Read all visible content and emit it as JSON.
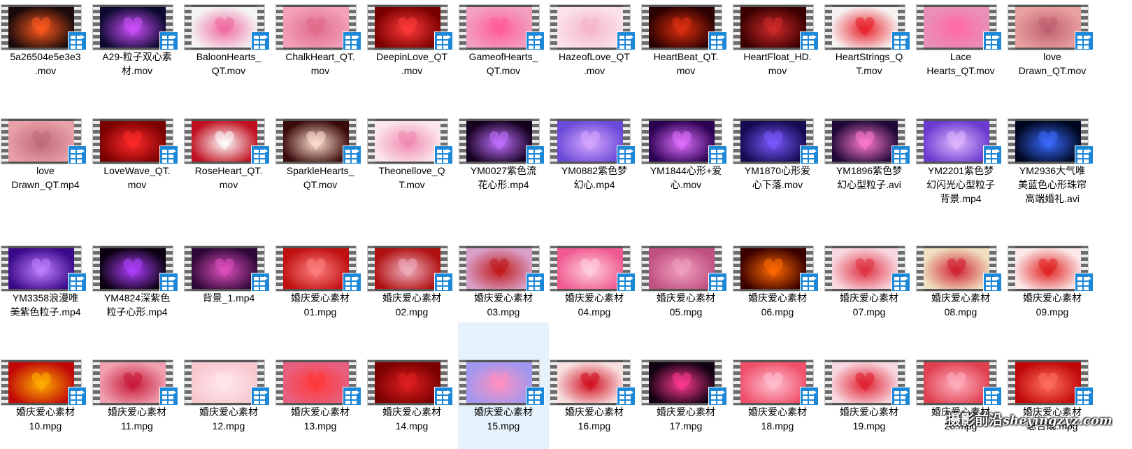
{
  "files": [
    {
      "name": "5a26504e5e3e3\n.mov",
      "colors": [
        "#1a0a0a",
        "#ff5a1e"
      ]
    },
    {
      "name": "A29-粒子双心素\n材.mov",
      "colors": [
        "#0c0a30",
        "#d050ff"
      ]
    },
    {
      "name": "BaloonHearts_\nQT.mov",
      "colors": [
        "#f4f4f4",
        "#f06aa0"
      ]
    },
    {
      "name": "ChalkHeart_QT.\nmov",
      "colors": [
        "#f3a0b8",
        "#e06a8a"
      ]
    },
    {
      "name": "DeepinLove_QT\n.mov",
      "colors": [
        "#7a0000",
        "#ff3a3a"
      ]
    },
    {
      "name": "GameofHearts_\nQT.mov",
      "colors": [
        "#f2a0c0",
        "#ff5c98"
      ]
    },
    {
      "name": "HazeofLove_QT\n.mov",
      "colors": [
        "#fbe2ea",
        "#f5b5c8"
      ]
    },
    {
      "name": "HeartBeat_QT.\nmov",
      "colors": [
        "#2a0000",
        "#e03010"
      ]
    },
    {
      "name": "HeartFloat_HD.\nmov",
      "colors": [
        "#3a0000",
        "#d02a2a"
      ]
    },
    {
      "name": "HeartStrings_Q\nT.mov",
      "colors": [
        "#f7f2f2",
        "#e8202a"
      ]
    },
    {
      "name": "Lace\nHearts_QT.mov",
      "colors": [
        "#e890b8",
        "#ff6aa8"
      ]
    },
    {
      "name": "love\nDrawn_QT.mov",
      "colors": [
        "#e8a0a0",
        "#c06070"
      ]
    },
    {
      "name": "love\nDrawn_QT.mp4",
      "colors": [
        "#e8a0a8",
        "#c06a78"
      ]
    },
    {
      "name": "LoveWave_QT.\nmov",
      "colors": [
        "#7a0000",
        "#ff2a2a"
      ]
    },
    {
      "name": "RoseHeart_QT.\nmov",
      "colors": [
        "#c01020",
        "#ffffff"
      ]
    },
    {
      "name": "SparkleHearts_\nQT.mov",
      "colors": [
        "#3a0a0a",
        "#ffe0d0"
      ]
    },
    {
      "name": "Theonellove_Q\nT.mov",
      "colors": [
        "#fbe6ee",
        "#f08ab0"
      ]
    },
    {
      "name": "YM0027紫色流\n花心形.mp4",
      "colors": [
        "#14001e",
        "#c070ff"
      ]
    },
    {
      "name": "YM0882紫色梦\n幻心.mp4",
      "colors": [
        "#6a4ad8",
        "#d8a8ff"
      ]
    },
    {
      "name": "YM1844心形+爱\n心.mov",
      "colors": [
        "#2a0050",
        "#e070ff"
      ]
    },
    {
      "name": "YM1870心形爱\n心下落.mov",
      "colors": [
        "#140a50",
        "#7a5aff"
      ]
    },
    {
      "name": "YM1896紫色梦\n幻心型粒子.avi",
      "colors": [
        "#20083a",
        "#ff7ad0"
      ]
    },
    {
      "name": "YM2201紫色梦\n幻闪光心型粒子\n背景.mp4",
      "colors": [
        "#6a3ad0",
        "#e0b8ff"
      ]
    },
    {
      "name": "YM2936大气唯\n美蓝色心形珠帘\n高端婚礼.avi",
      "colors": [
        "#000820",
        "#3a6aff"
      ]
    },
    {
      "name": "YM3358浪漫唯\n美紫色粒子.mp4",
      "colors": [
        "#3a0a8a",
        "#c080ff"
      ]
    },
    {
      "name": "YM4824深紫色\n粒子心形.mp4",
      "colors": [
        "#0a0010",
        "#b040ff"
      ]
    },
    {
      "name": "背景_1.mp4",
      "colors": [
        "#300838",
        "#e050c0"
      ]
    },
    {
      "name": "婚庆爱心素材\n01.mpg",
      "colors": [
        "#c01010",
        "#ff8080"
      ]
    },
    {
      "name": "婚庆爱心素材\n02.mpg",
      "colors": [
        "#b01010",
        "#f0b0c0"
      ]
    },
    {
      "name": "婚庆爱心素材\n03.mpg",
      "colors": [
        "#d8a0c8",
        "#c01818"
      ]
    },
    {
      "name": "婚庆爱心素材\n04.mpg",
      "colors": [
        "#f05a90",
        "#ffd0e0"
      ]
    },
    {
      "name": "婚庆爱心素材\n05.mpg",
      "colors": [
        "#c05080",
        "#f0a0c0"
      ]
    },
    {
      "name": "婚庆爱心素材\n06.mpg",
      "colors": [
        "#3a0000",
        "#ff6a00"
      ]
    },
    {
      "name": "婚庆爱心素材\n07.mpg",
      "colors": [
        "#f8d8e0",
        "#e03040"
      ]
    },
    {
      "name": "婚庆爱心素材\n08.mpg",
      "colors": [
        "#f0e0c0",
        "#d02030"
      ]
    },
    {
      "name": "婚庆爱心素材\n09.mpg",
      "colors": [
        "#fbe8e8",
        "#e02020"
      ]
    },
    {
      "name": "婚庆爱心素材\n10.mpg",
      "colors": [
        "#c00808",
        "#ffb000"
      ]
    },
    {
      "name": "婚庆爱心素材\n11.mpg",
      "colors": [
        "#f0a0b0",
        "#c81838"
      ]
    },
    {
      "name": "婚庆爱心素材\n12.mpg",
      "colors": [
        "#f8c8d0",
        "#ffe8ec"
      ]
    },
    {
      "name": "婚庆爱心素材\n13.mpg",
      "colors": [
        "#e86080",
        "#ff3a3a"
      ]
    },
    {
      "name": "婚庆爱心素材\n14.mpg",
      "colors": [
        "#7a0000",
        "#e02020"
      ]
    },
    {
      "name": "婚庆爱心素材\n15.mpg",
      "colors": [
        "#a098f0",
        "#ff90c0"
      ],
      "selected": true
    },
    {
      "name": "婚庆爱心素材\n16.mpg",
      "colors": [
        "#f8e0e0",
        "#d01020"
      ]
    },
    {
      "name": "婚庆爱心素材\n17.mpg",
      "colors": [
        "#100010",
        "#ff3a90"
      ]
    },
    {
      "name": "婚庆爱心素材\n18.mpg",
      "colors": [
        "#f0506a",
        "#ffc0d0"
      ]
    },
    {
      "name": "婚庆爱心素材\n19.mpg",
      "colors": [
        "#f8d8e0",
        "#e02030"
      ]
    },
    {
      "name": "婚庆爱心素材\n20.mpg",
      "colors": [
        "#e04050",
        "#ffb0c0"
      ]
    },
    {
      "name": "婚庆爱心素材\n总合成.mpg",
      "colors": [
        "#c00808",
        "#ff7060"
      ]
    }
  ],
  "watermark": {
    "chinese": "摄影前沿",
    "domain": "sheyingzyz.com"
  }
}
